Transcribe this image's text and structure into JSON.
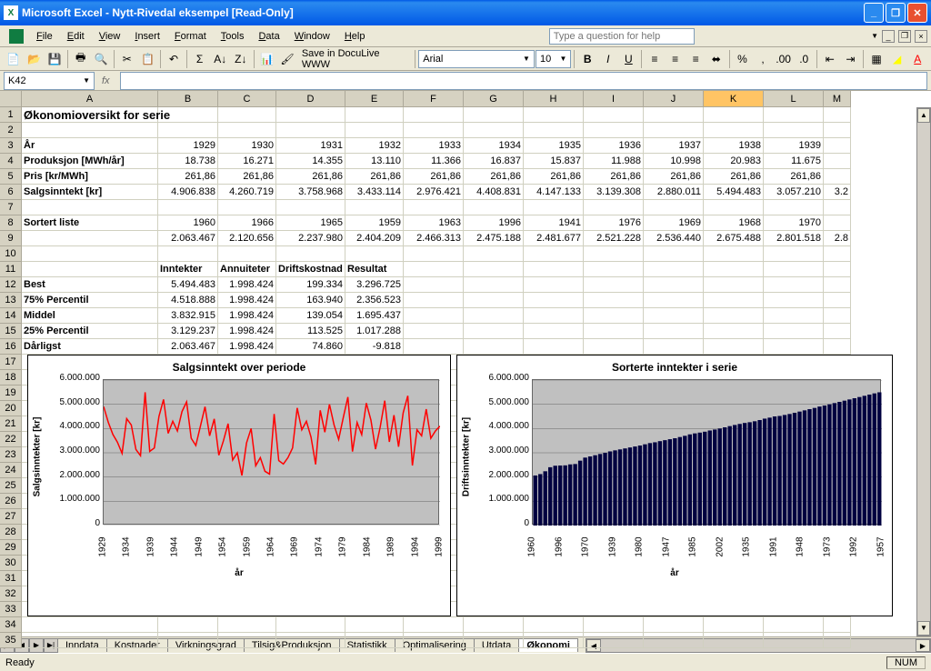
{
  "title": "Microsoft Excel - Nytt-Rivedal eksempel  [Read-Only]",
  "menu": [
    "File",
    "Edit",
    "View",
    "Insert",
    "Format",
    "Tools",
    "Data",
    "Window",
    "Help"
  ],
  "help_placeholder": "Type a question for help",
  "save_docu": "Save in DocuLive WWW",
  "font_name": "Arial",
  "font_size": "10",
  "namebox": "K42",
  "status": "Ready",
  "num_indicator": "NUM",
  "col_widths": {
    "A": 150,
    "B": 66,
    "C": 64,
    "D": 76,
    "E": 64,
    "F": 66,
    "G": 66,
    "H": 66,
    "I": 66,
    "J": 66,
    "K": 66,
    "L": 66,
    "M": 30
  },
  "cols": [
    "A",
    "B",
    "C",
    "D",
    "E",
    "F",
    "G",
    "H",
    "I",
    "J",
    "K",
    "L",
    "M"
  ],
  "selected_col": "K",
  "rows": 35,
  "cell_data": {
    "A1": {
      "v": "Økonomioversikt for serie",
      "c": "bold"
    },
    "A3": {
      "v": "År",
      "c": "hdr"
    },
    "A4": {
      "v": "Produksjon [MWh/år]",
      "c": "hdr"
    },
    "A5": {
      "v": "Pris [kr/MWh]",
      "c": "hdr"
    },
    "A6": {
      "v": "Salgsinntekt [kr]",
      "c": "hdr"
    },
    "A8": {
      "v": "Sortert liste",
      "c": "hdr"
    },
    "B3": {
      "v": "1929",
      "c": "r"
    },
    "C3": {
      "v": "1930",
      "c": "r"
    },
    "D3": {
      "v": "1931",
      "c": "r"
    },
    "E3": {
      "v": "1932",
      "c": "r"
    },
    "F3": {
      "v": "1933",
      "c": "r"
    },
    "G3": {
      "v": "1934",
      "c": "r"
    },
    "H3": {
      "v": "1935",
      "c": "r"
    },
    "I3": {
      "v": "1936",
      "c": "r"
    },
    "J3": {
      "v": "1937",
      "c": "r"
    },
    "K3": {
      "v": "1938",
      "c": "r"
    },
    "L3": {
      "v": "1939",
      "c": "r"
    },
    "B4": {
      "v": "18.738",
      "c": "r"
    },
    "C4": {
      "v": "16.271",
      "c": "r"
    },
    "D4": {
      "v": "14.355",
      "c": "r"
    },
    "E4": {
      "v": "13.110",
      "c": "r"
    },
    "F4": {
      "v": "11.366",
      "c": "r"
    },
    "G4": {
      "v": "16.837",
      "c": "r"
    },
    "H4": {
      "v": "15.837",
      "c": "r"
    },
    "I4": {
      "v": "11.988",
      "c": "r"
    },
    "J4": {
      "v": "10.998",
      "c": "r"
    },
    "K4": {
      "v": "20.983",
      "c": "r"
    },
    "L4": {
      "v": "11.675",
      "c": "r"
    },
    "B5": {
      "v": "261,86",
      "c": "r"
    },
    "C5": {
      "v": "261,86",
      "c": "r"
    },
    "D5": {
      "v": "261,86",
      "c": "r"
    },
    "E5": {
      "v": "261,86",
      "c": "r"
    },
    "F5": {
      "v": "261,86",
      "c": "r"
    },
    "G5": {
      "v": "261,86",
      "c": "r"
    },
    "H5": {
      "v": "261,86",
      "c": "r"
    },
    "I5": {
      "v": "261,86",
      "c": "r"
    },
    "J5": {
      "v": "261,86",
      "c": "r"
    },
    "K5": {
      "v": "261,86",
      "c": "r"
    },
    "L5": {
      "v": "261,86",
      "c": "r"
    },
    "B6": {
      "v": "4.906.838",
      "c": "r"
    },
    "C6": {
      "v": "4.260.719",
      "c": "r"
    },
    "D6": {
      "v": "3.758.968",
      "c": "r"
    },
    "E6": {
      "v": "3.433.114",
      "c": "r"
    },
    "F6": {
      "v": "2.976.421",
      "c": "r"
    },
    "G6": {
      "v": "4.408.831",
      "c": "r"
    },
    "H6": {
      "v": "4.147.133",
      "c": "r"
    },
    "I6": {
      "v": "3.139.308",
      "c": "r"
    },
    "J6": {
      "v": "2.880.011",
      "c": "r"
    },
    "K6": {
      "v": "5.494.483",
      "c": "r"
    },
    "L6": {
      "v": "3.057.210",
      "c": "r"
    },
    "M6": {
      "v": "3.2",
      "c": "r"
    },
    "B8": {
      "v": "1960",
      "c": "r"
    },
    "C8": {
      "v": "1966",
      "c": "r"
    },
    "D8": {
      "v": "1965",
      "c": "r"
    },
    "E8": {
      "v": "1959",
      "c": "r"
    },
    "F8": {
      "v": "1963",
      "c": "r"
    },
    "G8": {
      "v": "1996",
      "c": "r"
    },
    "H8": {
      "v": "1941",
      "c": "r"
    },
    "I8": {
      "v": "1976",
      "c": "r"
    },
    "J8": {
      "v": "1969",
      "c": "r"
    },
    "K8": {
      "v": "1968",
      "c": "r"
    },
    "L8": {
      "v": "1970",
      "c": "r"
    },
    "B9": {
      "v": "2.063.467",
      "c": "r"
    },
    "C9": {
      "v": "2.120.656",
      "c": "r"
    },
    "D9": {
      "v": "2.237.980",
      "c": "r"
    },
    "E9": {
      "v": "2.404.209",
      "c": "r"
    },
    "F9": {
      "v": "2.466.313",
      "c": "r"
    },
    "G9": {
      "v": "2.475.188",
      "c": "r"
    },
    "H9": {
      "v": "2.481.677",
      "c": "r"
    },
    "I9": {
      "v": "2.521.228",
      "c": "r"
    },
    "J9": {
      "v": "2.536.440",
      "c": "r"
    },
    "K9": {
      "v": "2.675.488",
      "c": "r"
    },
    "L9": {
      "v": "2.801.518",
      "c": "r"
    },
    "M9": {
      "v": "2.8",
      "c": "r"
    },
    "B11": {
      "v": "Inntekter",
      "c": "hdr"
    },
    "C11": {
      "v": "Annuiteter",
      "c": "hdr"
    },
    "D11": {
      "v": "Driftskostnad",
      "c": "hdr"
    },
    "E11": {
      "v": "Resultat",
      "c": "hdr"
    },
    "A12": {
      "v": "Best",
      "c": "hdr"
    },
    "B12": {
      "v": "5.494.483",
      "c": "r"
    },
    "C12": {
      "v": "1.998.424",
      "c": "r"
    },
    "D12": {
      "v": "199.334",
      "c": "r"
    },
    "E12": {
      "v": "3.296.725",
      "c": "r"
    },
    "A13": {
      "v": "75% Percentil",
      "c": "hdr"
    },
    "B13": {
      "v": "4.518.888",
      "c": "r"
    },
    "C13": {
      "v": "1.998.424",
      "c": "r"
    },
    "D13": {
      "v": "163.940",
      "c": "r"
    },
    "E13": {
      "v": "2.356.523",
      "c": "r"
    },
    "A14": {
      "v": "Middel",
      "c": "hdr"
    },
    "B14": {
      "v": "3.832.915",
      "c": "r"
    },
    "C14": {
      "v": "1.998.424",
      "c": "r"
    },
    "D14": {
      "v": "139.054",
      "c": "r"
    },
    "E14": {
      "v": "1.695.437",
      "c": "r"
    },
    "A15": {
      "v": "25% Percentil",
      "c": "hdr"
    },
    "B15": {
      "v": "3.129.237",
      "c": "r"
    },
    "C15": {
      "v": "1.998.424",
      "c": "r"
    },
    "D15": {
      "v": "113.525",
      "c": "r"
    },
    "E15": {
      "v": "1.017.288",
      "c": "r"
    },
    "A16": {
      "v": "Dårligst",
      "c": "hdr"
    },
    "B16": {
      "v": "2.063.467",
      "c": "r"
    },
    "C16": {
      "v": "1.998.424",
      "c": "r"
    },
    "D16": {
      "v": "74.860",
      "c": "r"
    },
    "E16": {
      "v": "-9.818",
      "c": "r"
    }
  },
  "sheet_tabs": [
    "Inndata",
    "Kostnader",
    "Virkningsgrad",
    "Tilsig&Produksjon",
    "Statistikk",
    "Optimalisering",
    "Utdata",
    "Økonomi"
  ],
  "active_tab": "Økonomi",
  "chart_data": [
    {
      "type": "line",
      "title": "Salgsinntekt over periode",
      "xlabel": "år",
      "ylabel": "Salgsinntekter [kr]",
      "ylim": [
        0,
        6000000
      ],
      "y_ticks": [
        "0",
        "1.000.000",
        "2.000.000",
        "3.000.000",
        "4.000.000",
        "5.000.000",
        "6.000.000"
      ],
      "x_ticks": [
        "1929",
        "1934",
        "1939",
        "1944",
        "1949",
        "1954",
        "1959",
        "1964",
        "1969",
        "1974",
        "1979",
        "1984",
        "1989",
        "1994",
        "1999"
      ],
      "series": [
        {
          "name": "Salgsinntekt",
          "color": "#ff0000",
          "values": [
            4906838,
            4260719,
            3758968,
            3433114,
            2976421,
            4408831,
            4147133,
            3139308,
            2880011,
            5494483,
            3057210,
            3200000,
            4500000,
            5200000,
            3800000,
            4300000,
            3900000,
            4700000,
            5100000,
            3600000,
            3300000,
            4100000,
            4900000,
            3700000,
            4400000,
            2900000,
            3500000,
            4200000,
            2700000,
            3000000,
            2063467,
            3400000,
            4000000,
            2466313,
            2800000,
            2237980,
            2120656,
            4600000,
            2675488,
            2536440,
            2801518,
            3200000,
            4850000,
            3950000,
            4300000,
            3650000,
            2521228,
            4750000,
            3850000,
            5000000,
            4150000,
            3550000,
            4450000,
            5300000,
            3050000,
            4250000,
            3750000,
            5050000,
            4350000,
            3150000,
            4050000,
            5150000,
            3450000,
            4550000,
            3250000,
            4650000,
            5350000,
            2475188,
            3950000,
            3700000,
            4800000,
            3600000,
            3900000,
            4100000
          ]
        }
      ]
    },
    {
      "type": "bar",
      "title": "Sorterte inntekter i serie",
      "xlabel": "år",
      "ylabel": "Driftsinntekter [kr]",
      "ylim": [
        0,
        6000000
      ],
      "y_ticks": [
        "0",
        "1.000.000",
        "2.000.000",
        "3.000.000",
        "4.000.000",
        "5.000.000",
        "6.000.000"
      ],
      "x_ticks": [
        "1960",
        "1996",
        "1970",
        "1939",
        "1980",
        "1947",
        "1985",
        "2002",
        "1935",
        "1991",
        "1948",
        "1973",
        "1992",
        "1957"
      ],
      "categories_full": [
        "1960",
        "1966",
        "1965",
        "1959",
        "1963",
        "1996",
        "1941",
        "1976",
        "1969",
        "1968",
        "1970"
      ],
      "values": [
        2063467,
        2120656,
        2237980,
        2404209,
        2466313,
        2475188,
        2481677,
        2521228,
        2536440,
        2675488,
        2801518,
        2850000,
        2900000,
        2950000,
        3000000,
        3057210,
        3100000,
        3139308,
        3180000,
        3220000,
        3260000,
        3300000,
        3350000,
        3400000,
        3433114,
        3480000,
        3520000,
        3560000,
        3600000,
        3650000,
        3700000,
        3758968,
        3800000,
        3832915,
        3870000,
        3920000,
        3960000,
        4000000,
        4050000,
        4100000,
        4147133,
        4190000,
        4230000,
        4260719,
        4300000,
        4350000,
        4408831,
        4450000,
        4500000,
        4518888,
        4560000,
        4600000,
        4650000,
        4700000,
        4750000,
        4800000,
        4850000,
        4906838,
        4950000,
        5000000,
        5050000,
        5100000,
        5150000,
        5200000,
        5250000,
        5300000,
        5350000,
        5400000,
        5450000,
        5494483
      ]
    }
  ]
}
